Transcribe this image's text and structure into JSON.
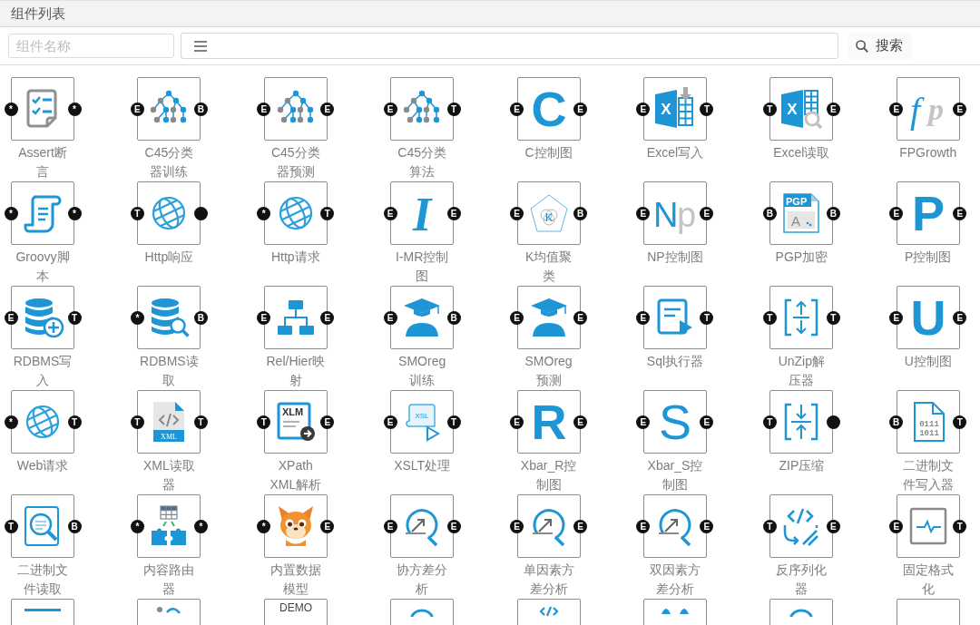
{
  "panel": {
    "title": "组件列表"
  },
  "search": {
    "name_field": {
      "placeholder": "组件名称"
    },
    "search_button": {
      "label": "搜索"
    }
  },
  "components": [
    {
      "label": "Assert断言",
      "kind": "checklist",
      "ports": {
        "in": "*",
        "out": "*"
      }
    },
    {
      "label": "C45分类器训练",
      "kind": "tree",
      "ports": {
        "in": "E",
        "out": "B"
      }
    },
    {
      "label": "C45分类器预测",
      "kind": "tree",
      "ports": {
        "in": "E",
        "out": "E"
      }
    },
    {
      "label": "C45分类算法",
      "kind": "tree",
      "ports": {
        "in": "E",
        "out": "T"
      }
    },
    {
      "label": "C控制图",
      "kind": "letter",
      "icon_text": [
        "C"
      ],
      "ports": {
        "in": "E",
        "out": "E"
      }
    },
    {
      "label": "Excel写入",
      "kind": "excel-write",
      "icon_text": [
        "X"
      ],
      "ports": {
        "in": "E",
        "out": "T"
      }
    },
    {
      "label": "Excel读取",
      "kind": "excel-read",
      "icon_text": [
        "X"
      ],
      "ports": {
        "in": "T",
        "out": "E"
      }
    },
    {
      "label": "FPGrowth",
      "kind": "formula",
      "icon_text": [
        "f",
        "p"
      ],
      "ports": {
        "in": "E",
        "out": "E"
      }
    },
    {
      "label": "Groovy脚本",
      "kind": "scroll",
      "ports": {
        "in": "*",
        "out": "*"
      }
    },
    {
      "label": "Http响应",
      "kind": "globe",
      "ports": {
        "in": "T"
      }
    },
    {
      "label": "Http请求",
      "kind": "globe",
      "ports": {
        "in": "*",
        "out": "T"
      }
    },
    {
      "label": "I-MR控制图",
      "kind": "serif-letter",
      "icon_text": [
        "I"
      ],
      "ports": {
        "in": "E",
        "out": "E"
      }
    },
    {
      "label": "K均值聚类",
      "kind": "pentagon",
      "icon_text": [
        "K"
      ],
      "ports": {
        "in": "E",
        "out": "B"
      }
    },
    {
      "label": "NP控制图",
      "kind": "letter-pair",
      "icon_text": [
        "N",
        "p"
      ],
      "ports": {
        "in": "E",
        "out": "E"
      }
    },
    {
      "label": "PGP加密",
      "kind": "pgp-doc",
      "icon_text": [
        "PGP",
        "A"
      ],
      "ports": {
        "in": "B",
        "out": "B"
      }
    },
    {
      "label": "P控制图",
      "kind": "letter",
      "icon_text": [
        "P"
      ],
      "ports": {
        "in": "E",
        "out": "E"
      }
    },
    {
      "label": "RDBMS写入",
      "kind": "database-plus",
      "ports": {
        "in": "E",
        "out": "T"
      }
    },
    {
      "label": "RDBMS读取",
      "kind": "database-search",
      "ports": {
        "in": "*",
        "out": "B"
      }
    },
    {
      "label": "Rel/Hier映射",
      "kind": "hierarchy",
      "ports": {
        "in": "E",
        "out": "E"
      }
    },
    {
      "label": "SMOreg训练",
      "kind": "graduate",
      "ports": {
        "in": "E",
        "out": "B"
      }
    },
    {
      "label": "SMOreg预测",
      "kind": "graduate",
      "ports": {
        "in": "E",
        "out": "E"
      }
    },
    {
      "label": "Sql执行器",
      "kind": "sql-run",
      "ports": {
        "in": "E",
        "out": "T"
      }
    },
    {
      "label": "UnZip解压器",
      "kind": "unzip",
      "ports": {
        "in": "T",
        "out": "T"
      }
    },
    {
      "label": "U控制图",
      "kind": "letter",
      "icon_text": [
        "U"
      ],
      "ports": {
        "in": "E",
        "out": "E"
      }
    },
    {
      "label": "Web请求",
      "kind": "globe",
      "ports": {
        "in": "*",
        "out": "T"
      }
    },
    {
      "label": "XML读取器",
      "kind": "xml-file",
      "icon_text": [
        "XML"
      ],
      "ports": {
        "in": "T",
        "out": "T"
      }
    },
    {
      "label": "XPath XML解析",
      "kind": "xlm-doc",
      "icon_text": [
        "XLM"
      ],
      "ports": {
        "in": "T",
        "out": "E"
      }
    },
    {
      "label": "XSLT处理",
      "kind": "xsl-scroll",
      "icon_text": [
        "XSL"
      ],
      "ports": {
        "in": "E",
        "out": "T"
      }
    },
    {
      "label": "Xbar_R控制图",
      "kind": "letter",
      "icon_text": [
        "R"
      ],
      "ports": {
        "in": "E",
        "out": "E"
      }
    },
    {
      "label": "Xbar_S控制图",
      "kind": "light-letter",
      "icon_text": [
        "S"
      ],
      "ports": {
        "in": "E",
        "out": "E"
      }
    },
    {
      "label": "ZIP压缩",
      "kind": "zip",
      "ports": {
        "in": "T"
      }
    },
    {
      "label": "二进制文件写入器",
      "kind": "binary-file",
      "icon_text": [
        "0111",
        "1011"
      ],
      "ports": {
        "in": "B",
        "out": "T"
      }
    },
    {
      "label": "二进制文件读取",
      "kind": "binary-search",
      "ports": {
        "in": "T",
        "out": "B"
      }
    },
    {
      "label": "内容路由器",
      "kind": "router",
      "ports": {
        "in": "*",
        "out": "*"
      }
    },
    {
      "label": "内置数据模型",
      "kind": "mascot",
      "ports": {
        "in": "*",
        "out": "E"
      }
    },
    {
      "label": "协方差分析",
      "kind": "analysis",
      "ports": {
        "in": "E",
        "out": "E"
      }
    },
    {
      "label": "单因素方差分析",
      "kind": "analysis",
      "ports": {
        "in": "E",
        "out": "E"
      }
    },
    {
      "label": "双因素方差分析",
      "kind": "analysis",
      "ports": {
        "in": "E",
        "out": "E"
      }
    },
    {
      "label": "反序列化器",
      "kind": "deserialize",
      "ports": {
        "in": "T",
        "out": "E"
      }
    },
    {
      "label": "固定格式化",
      "kind": "monitor-pulse",
      "ports": {
        "in": "E",
        "out": "T"
      }
    },
    {
      "kind": "partial-bar"
    },
    {
      "kind": "partial-person"
    },
    {
      "kind": "partial-demo",
      "icon_text": [
        "DEMO"
      ]
    },
    {
      "kind": "partial-arc"
    },
    {
      "kind": "partial-code"
    },
    {
      "kind": "partial-blobs"
    },
    {
      "kind": "partial-arc"
    },
    {
      "kind": "empty"
    }
  ]
}
